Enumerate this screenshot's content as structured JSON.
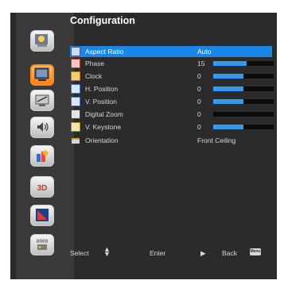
{
  "title": "Configuration",
  "sidebar": {
    "items": [
      {
        "icon": "image-settings-icon"
      },
      {
        "icon": "display-settings-icon"
      },
      {
        "icon": "setup-icon"
      },
      {
        "icon": "audio-icon",
        "glyph": "◀))"
      },
      {
        "icon": "options-icon"
      },
      {
        "icon": "3d-icon",
        "label": "3D"
      },
      {
        "icon": "lan-icon"
      },
      {
        "icon": "network-icon",
        "label": "0000"
      }
    ],
    "active_index": 1
  },
  "rows": [
    {
      "label": "Aspect Ratio",
      "value": "Auto",
      "icon": "aspect-ratio-icon"
    },
    {
      "label": "Phase",
      "value": "15",
      "level": 0.55,
      "icon": "phase-icon"
    },
    {
      "label": "Clock",
      "value": "0",
      "level": 0.5,
      "icon": "clock-icon"
    },
    {
      "label": "H. Position",
      "value": "0",
      "level": 0.5,
      "icon": "h-position-icon"
    },
    {
      "label": "V. Position",
      "value": "0",
      "level": 0.5,
      "icon": "v-position-icon"
    },
    {
      "label": "Digital Zoom",
      "value": "0",
      "level": 0.0,
      "icon": "digital-zoom-icon"
    },
    {
      "label": "V. Keystone",
      "value": "0",
      "level": 0.5,
      "icon": "v-keystone-icon"
    },
    {
      "label": "Orientation",
      "value": "Front Ceiling",
      "icon": "orientation-icon"
    }
  ],
  "footer": {
    "select_label": "Select",
    "enter_label": "Enter",
    "back_label": "Back",
    "menu_key": "Menu"
  }
}
